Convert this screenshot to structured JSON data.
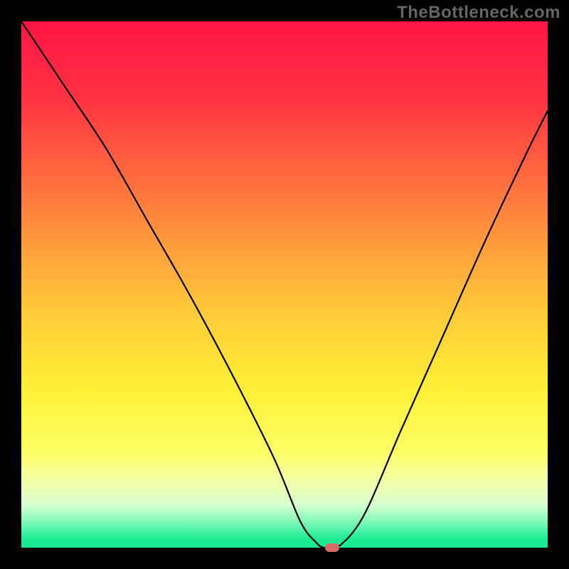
{
  "watermark": "TheBottleneck.com",
  "chart_data": {
    "type": "line",
    "title": "",
    "xlabel": "",
    "ylabel": "",
    "xlim": [
      0,
      100
    ],
    "ylim": [
      0,
      100
    ],
    "x": [
      0,
      8,
      16,
      24,
      32,
      40,
      48,
      53,
      56,
      57.5,
      60,
      65,
      72,
      80,
      88,
      96,
      100
    ],
    "values": [
      100,
      88,
      76,
      62,
      48,
      33,
      17,
      5,
      1,
      0,
      0,
      6,
      22,
      40,
      58,
      75,
      83
    ],
    "marker": {
      "x": 59,
      "y": 0
    },
    "gradient_stops": [
      {
        "offset": 0.0,
        "color": "#ff1544"
      },
      {
        "offset": 0.14,
        "color": "#ff3042"
      },
      {
        "offset": 0.28,
        "color": "#ff643e"
      },
      {
        "offset": 0.42,
        "color": "#ff9a3c"
      },
      {
        "offset": 0.56,
        "color": "#ffcc38"
      },
      {
        "offset": 0.7,
        "color": "#fff035"
      },
      {
        "offset": 0.82,
        "color": "#fcff67"
      },
      {
        "offset": 0.88,
        "color": "#f2ffad"
      },
      {
        "offset": 0.92,
        "color": "#d4ffd0"
      },
      {
        "offset": 0.955,
        "color": "#72f8b5"
      },
      {
        "offset": 0.985,
        "color": "#18eb92"
      },
      {
        "offset": 1.0,
        "color": "#17ea91"
      }
    ]
  }
}
